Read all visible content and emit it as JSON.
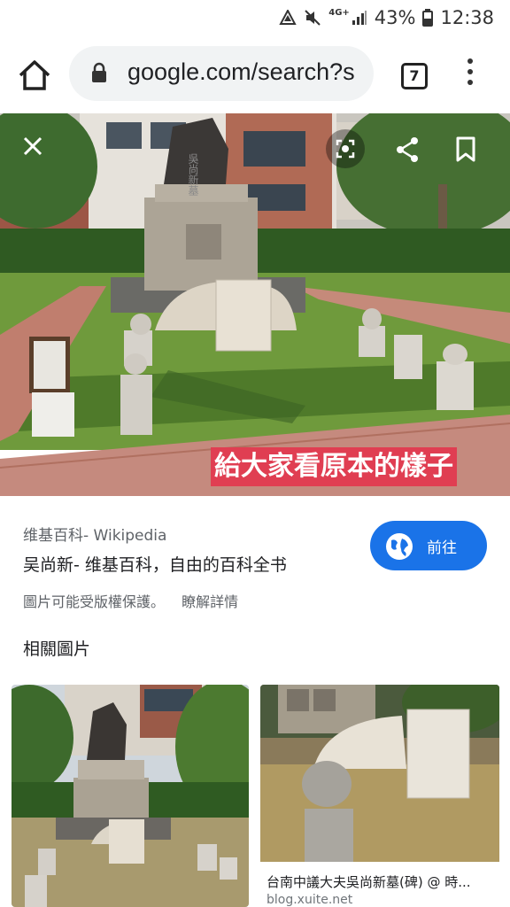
{
  "status_bar": {
    "network": "4G+",
    "battery": "43%",
    "time": "12:38"
  },
  "browser": {
    "url": "google.com/search?s",
    "tab_count": "7"
  },
  "hero": {
    "caption": "給大家看原本的樣子",
    "monument_inscription": "吳尚新墓"
  },
  "result": {
    "source": "维基百科- Wikipedia",
    "title": "吴尚新- 维基百科，自由的百科全书",
    "visit_label": "前往",
    "copyright": "圖片可能受版權保護。",
    "learn_more": "瞭解詳情"
  },
  "related": {
    "heading": "相關圖片",
    "items": [
      {
        "caption": "",
        "domain": ""
      },
      {
        "caption": "台南中議大夫吳尚新墓(碑) @ 時...",
        "domain": "blog.xuite.net"
      }
    ]
  },
  "colors": {
    "accent": "#1a73e8",
    "caption_bg": "#e03e52"
  }
}
